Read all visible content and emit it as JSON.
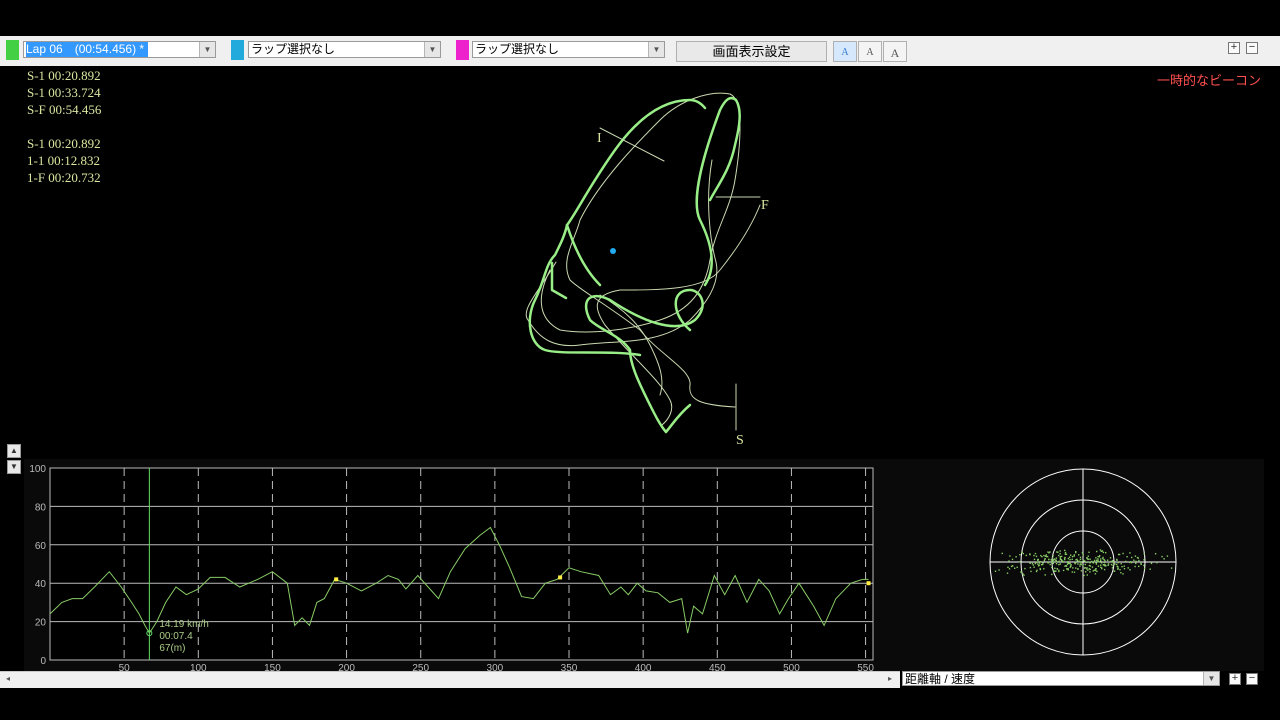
{
  "toolbar": {
    "lap1": {
      "color": "#44d044",
      "value": "Lap 06　(00:54.456) *"
    },
    "lap2": {
      "color": "#22aadd",
      "value": "ラップ選択なし"
    },
    "lap3": {
      "color": "#ee22cc",
      "value": "ラップ選択なし"
    },
    "display_settings_label": "画面表示設定",
    "font_size_buttons": [
      "A",
      "A",
      "A"
    ]
  },
  "lap_info": {
    "group1": [
      "S-1 00:20.892",
      "S-1 00:33.724",
      "S-F 00:54.456"
    ],
    "group2": [
      "S-1 00:20.892",
      "1-1 00:12.832",
      "1-F 00:20.732"
    ]
  },
  "beacon_label": "一時的なビーコン",
  "track_map": {
    "labels": {
      "start": "S",
      "finish": "F",
      "sector1": "I"
    },
    "colors": {
      "track": "#99ee88",
      "line_thin": "#c9d9b0",
      "marker": "#22aaee"
    }
  },
  "chart_data": {
    "type": "line",
    "xlabel": "",
    "ylabel": "",
    "xlim": [
      0,
      555
    ],
    "ylim": [
      0,
      100
    ],
    "x_ticks": [
      50,
      100,
      150,
      200,
      250,
      300,
      350,
      400,
      450,
      500,
      550
    ],
    "y_ticks": [
      0,
      20,
      40,
      60,
      80,
      100
    ],
    "grid": true,
    "series": [
      {
        "color": "#88cc66",
        "x": [
          0,
          8,
          15,
          22,
          30,
          40,
          48,
          55,
          60,
          64,
          67,
          72,
          78,
          85,
          92,
          100,
          108,
          118,
          128,
          140,
          150,
          160,
          165,
          170,
          175,
          180,
          185,
          192,
          200,
          210,
          220,
          228,
          235,
          240,
          248,
          255,
          262,
          270,
          280,
          290,
          297,
          303,
          310,
          318,
          326,
          334,
          342,
          350,
          358,
          370,
          378,
          385,
          390,
          396,
          402,
          410,
          418,
          426,
          430,
          434,
          440,
          448,
          455,
          462,
          470,
          478,
          485,
          492,
          498,
          505,
          510,
          515,
          522,
          530,
          540,
          548,
          552
        ],
        "values": [
          24,
          30,
          32,
          32,
          38,
          46,
          38,
          30,
          24,
          18,
          14,
          20,
          30,
          38,
          34,
          37,
          43,
          43,
          38,
          42,
          46,
          40,
          18,
          22,
          18,
          30,
          32,
          42,
          40,
          36,
          40,
          44,
          42,
          37,
          44,
          38,
          32,
          46,
          58,
          65,
          69,
          60,
          48,
          33,
          32,
          40,
          42,
          48,
          46,
          44,
          34,
          38,
          34,
          40,
          36,
          35,
          30,
          32,
          14,
          28,
          24,
          44,
          34,
          44,
          30,
          42,
          36,
          24,
          32,
          40,
          34,
          28,
          18,
          32,
          40,
          42,
          42
        ]
      }
    ],
    "markers": [
      {
        "x": 193,
        "y": 42
      },
      {
        "x": 344,
        "y": 43
      },
      {
        "x": 552,
        "y": 40
      }
    ],
    "cursor": {
      "x": 67,
      "y": 14,
      "readout": [
        "14.19 km/h",
        "00:07.4",
        "67(m)"
      ]
    }
  },
  "gg_plot": {
    "color": "#88cc66"
  },
  "axis_select": {
    "value": "距離軸 / 速度"
  }
}
